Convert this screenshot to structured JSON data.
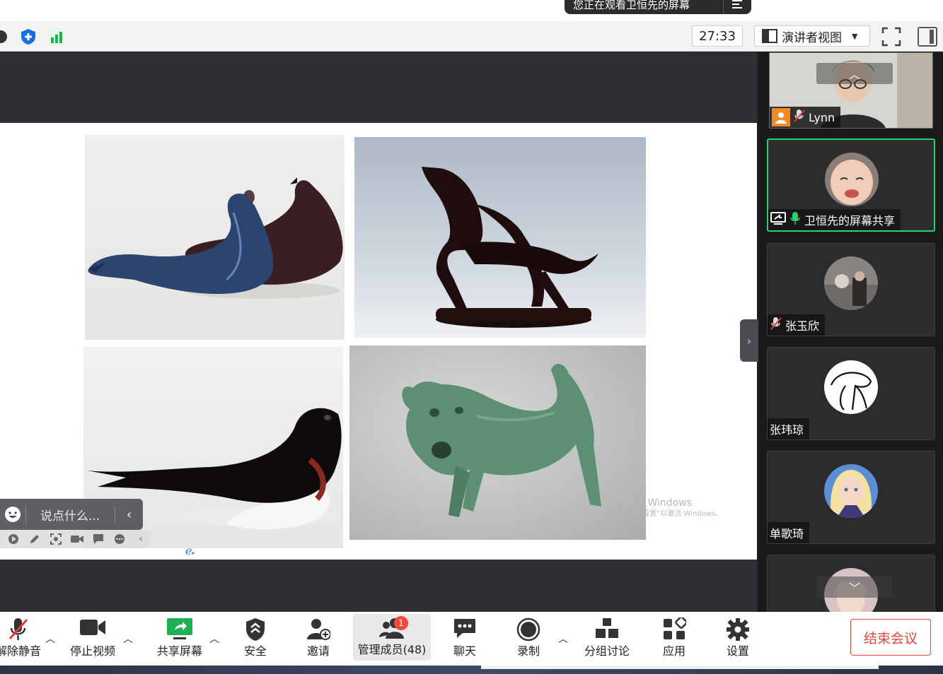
{
  "banner": {
    "text": "您正在观看卫恒先的屏幕",
    "menu_icon": "menu-lines-icon"
  },
  "toolbar": {
    "timer": "27:33",
    "view_label": "演讲者视图"
  },
  "slide": {
    "watermark_line1": "激活 Windows",
    "watermark_line2": "转到“设置”以激活 Windows。"
  },
  "chat": {
    "placeholder": "说点什么..."
  },
  "participants": [
    {
      "name": "Lynn",
      "muted": true,
      "video": true
    },
    {
      "name": "卫恒先的屏幕共享",
      "muted": false,
      "active": true
    },
    {
      "name": "张玉欣",
      "muted": true
    },
    {
      "name": "张玮琼",
      "muted": false
    },
    {
      "name": "单歌琦",
      "muted": false
    }
  ],
  "bottom_bar": {
    "unmute": "解除静音",
    "stop_video": "停止视频",
    "share_screen": "共享屏幕",
    "security": "安全",
    "invite": "邀请",
    "participants": "管理成员(48)",
    "participants_badge": "1",
    "chat": "聊天",
    "record": "录制",
    "breakout": "分组讨论",
    "apps": "应用",
    "settings": "设置",
    "end_meeting": "结束会议"
  },
  "colors": {
    "accent_green": "#2ed06e",
    "end_red": "#e04a3e",
    "badge_red": "#f04a3e"
  }
}
